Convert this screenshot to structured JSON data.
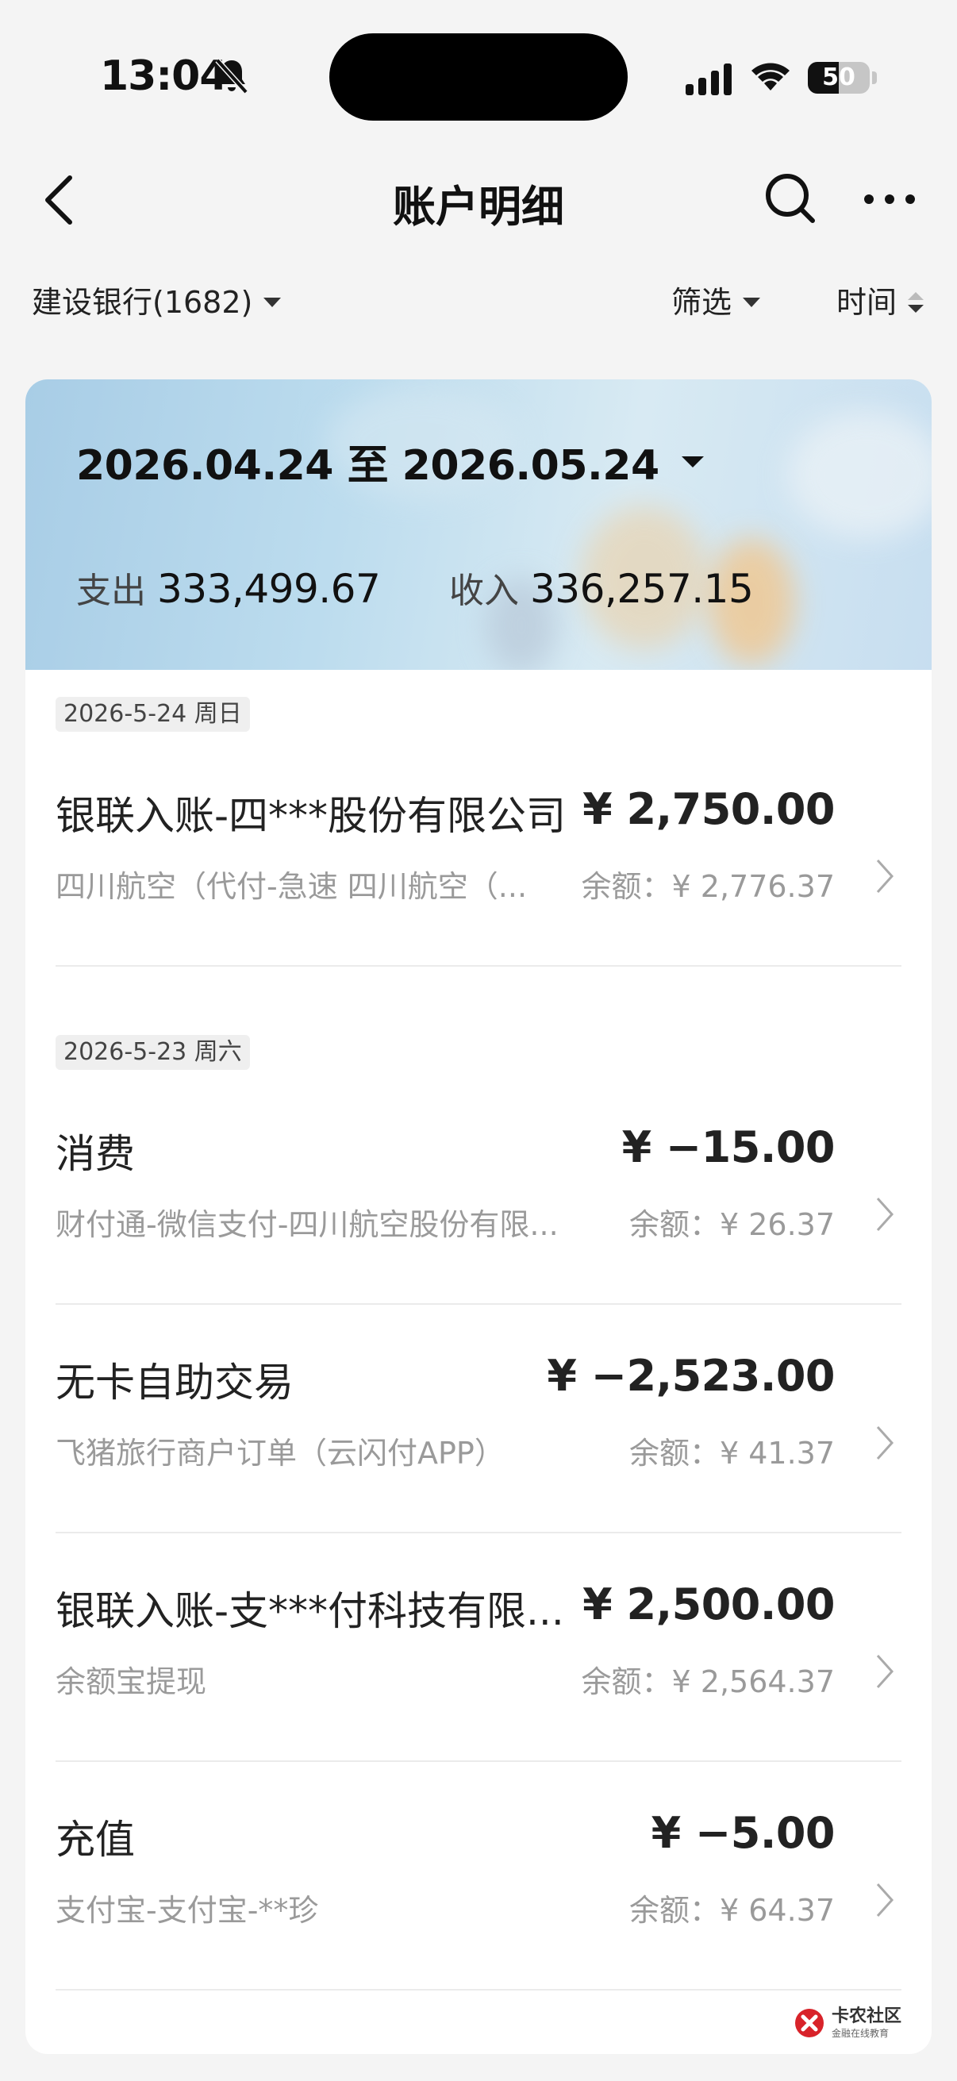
{
  "status_bar": {
    "time": "13:04",
    "battery": "50",
    "battery_level_percent": 50
  },
  "nav": {
    "title": "账户明细"
  },
  "filters": {
    "account": "建设银行(1682)",
    "filter": "筛选",
    "sort": "时间"
  },
  "summary": {
    "date_range": "2026.04.24 至 2026.05.24",
    "expense_label": "支出",
    "expense_value": "333,499.67",
    "income_label": "收入",
    "income_value": "336,257.15"
  },
  "groups": [
    {
      "date": "2026-5-24 周日",
      "transactions": [
        {
          "title": "银联入账-四***股份有限公司",
          "amount": "¥ 2,750.00",
          "description": "四川航空（代付-急速 四川航空（...",
          "balance": "余额：¥ 2,776.37"
        }
      ]
    },
    {
      "date": "2026-5-23 周六",
      "transactions": [
        {
          "title": "消费",
          "amount": "¥ −15.00",
          "description": "财付通-微信支付-四川航空股份有限...",
          "balance": "余额：¥ 26.37"
        },
        {
          "title": "无卡自助交易",
          "amount": "¥ −2,523.00",
          "description": "飞猪旅行商户订单（云闪付APP）",
          "balance": "余额：¥ 41.37"
        },
        {
          "title": "银联入账-支***付科技有限...",
          "amount": "¥ 2,500.00",
          "description": "余额宝提现",
          "balance": "余额：¥ 2,564.37"
        },
        {
          "title": "充值",
          "amount": "¥ −5.00",
          "description": "支付宝-支付宝-**珍",
          "balance": "余额：¥ 64.37"
        }
      ]
    }
  ],
  "watermark": {
    "main": "卡农社区",
    "sub": "金融在线教育"
  }
}
